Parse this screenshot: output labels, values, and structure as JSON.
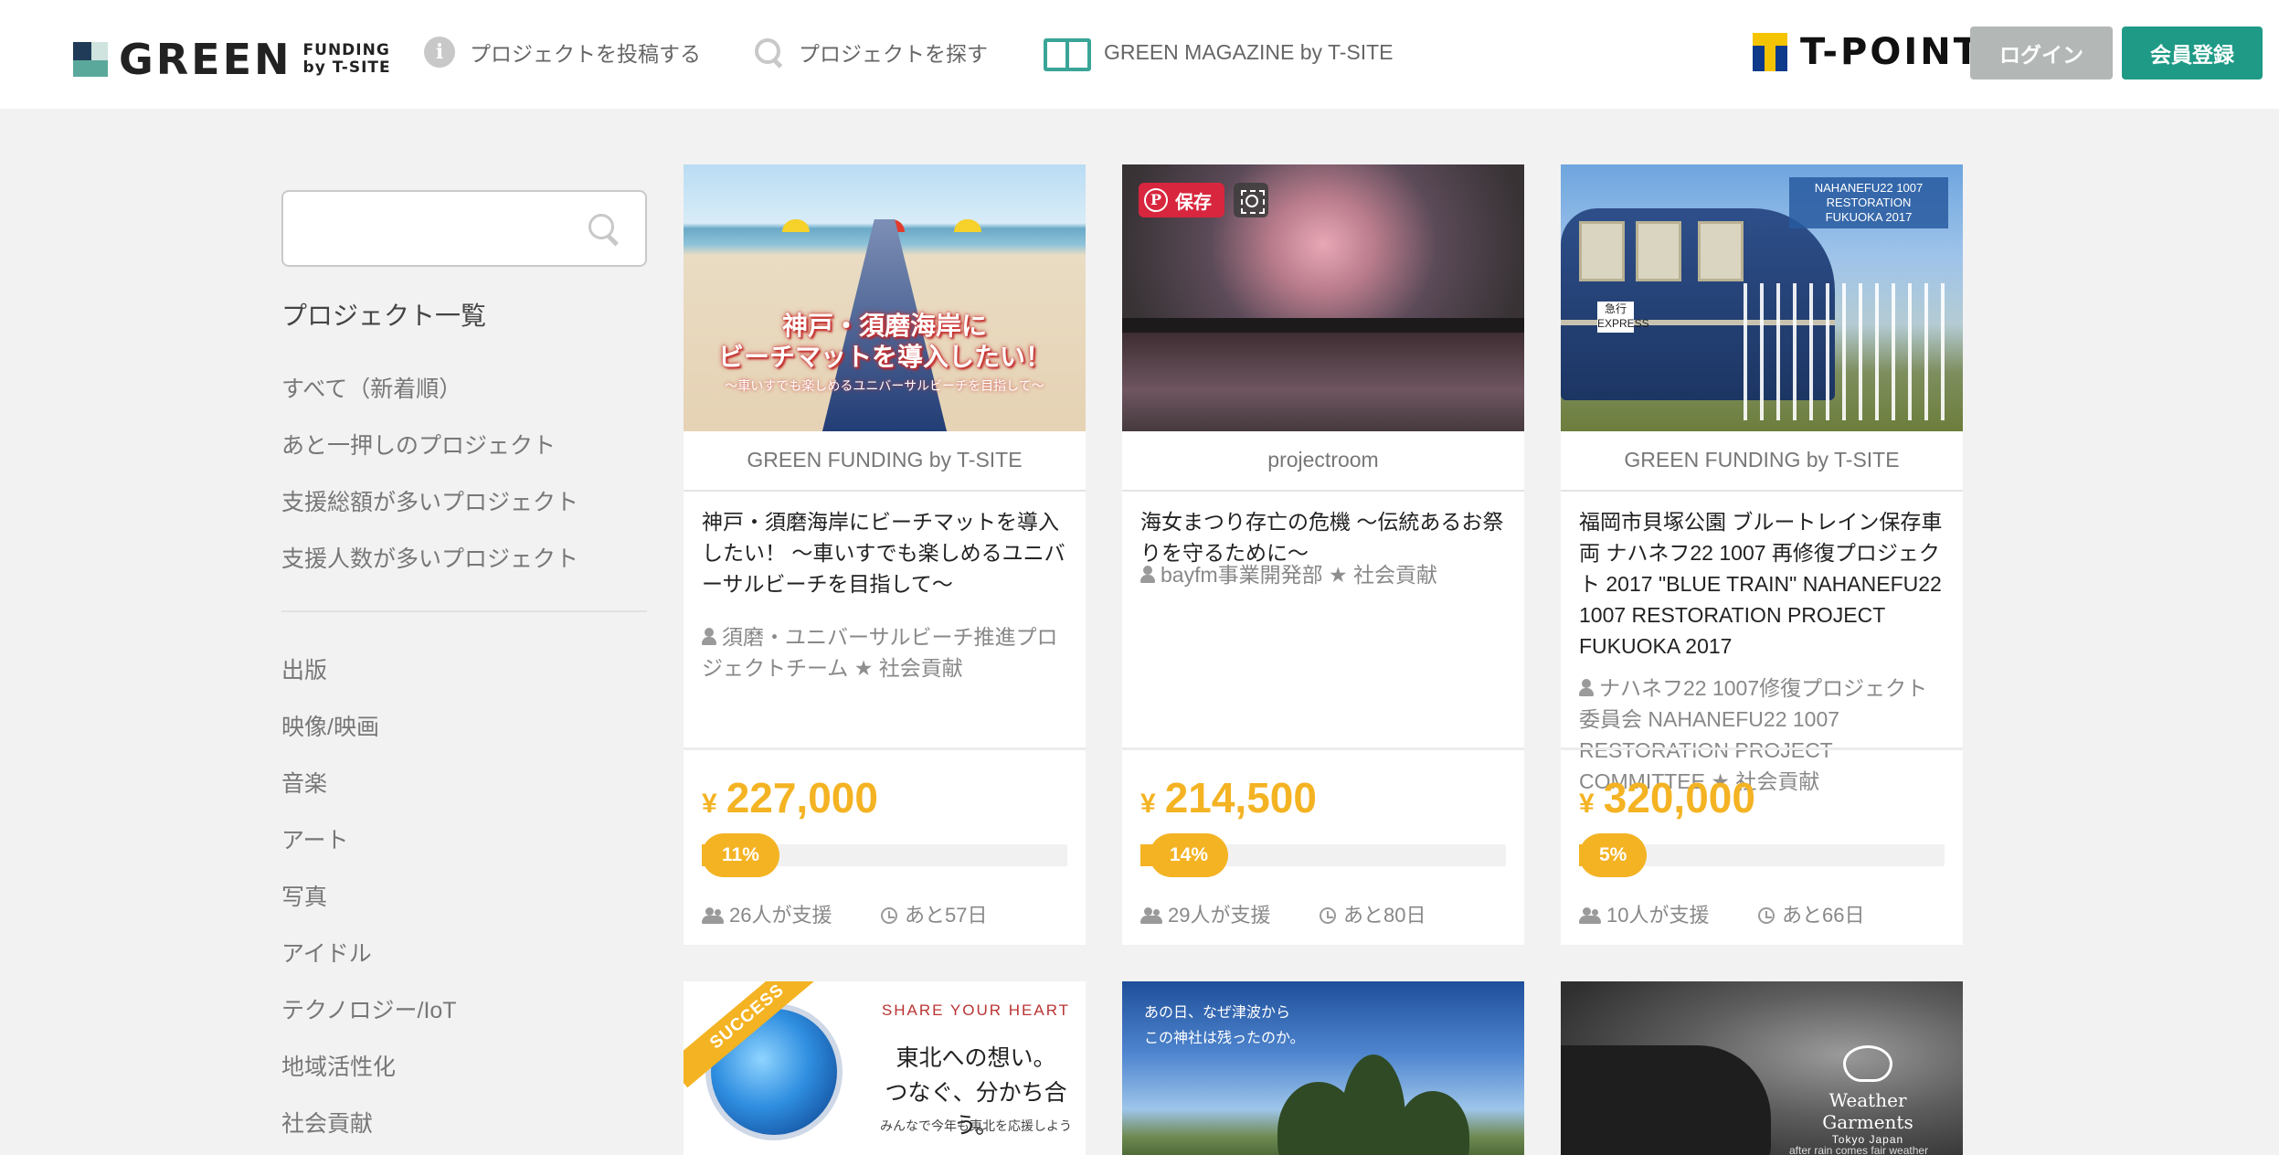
{
  "header": {
    "logo_main": "GREEN",
    "logo_sub_1": "FUNDING",
    "logo_sub_2": "by T-SITE",
    "nav": [
      {
        "label": "プロジェクトを投稿する",
        "icon": "info-icon"
      },
      {
        "label": "プロジェクトを探す",
        "icon": "search-icon"
      },
      {
        "label": "GREEN MAGAZINE by T-SITE",
        "icon": "book-icon"
      }
    ],
    "tpoint_label": "T-POINT",
    "login_label": "ログイン",
    "register_label": "会員登録"
  },
  "sidebar": {
    "search_placeholder": "",
    "heading": "プロジェクト一覧",
    "sort_links": [
      "すべて（新着順）",
      "あと一押しのプロジェクト",
      "支援総額が多いプロジェクト",
      "支援人数が多いプロジェクト"
    ],
    "categories": [
      "出版",
      "映像/映画",
      "音楽",
      "アート",
      "写真",
      "アイドル",
      "テクノロジー/IoT",
      "地域活性化",
      "社会貢献"
    ]
  },
  "cards": [
    {
      "org": "GREEN FUNDING by T-SITE",
      "title": "神戸・須磨海岸にビーチマットを導入したい！ 〜車いすでも楽しめるユニバーサルビーチを目指して〜",
      "owner": "須磨・ユニバーサルビーチ推進プロジェクトチーム",
      "tag": "社会貢献",
      "amount": "227,000",
      "percent": 11,
      "percent_label": "11%",
      "supporters": "26人が支援",
      "days_left": "あと57日",
      "image_title": "神戸・須磨海岸に\nビーチマットを導入したい！",
      "image_sub": "〜車いすでも楽しめるユニバーサルビーチを目指して〜"
    },
    {
      "org": "projectroom",
      "title": "海女まつり存亡の危機 〜伝統あるお祭りを守るために〜",
      "owner": "bayfm事業開発部",
      "tag": "社会貢献",
      "amount": "214,500",
      "percent": 14,
      "percent_label": "14%",
      "supporters": "29人が支援",
      "days_left": "あと80日",
      "pin_label": "保存"
    },
    {
      "org": "GREEN FUNDING by T-SITE",
      "title": "福岡市貝塚公園 ブルートレイン保存車両 ナハネフ22 1007 再修復プロジェクト 2017 \"BLUE TRAIN\" NAHANEFU22 1007 RESTORATION PROJECT FUKUOKA 2017",
      "owner": "ナハネフ22 1007修復プロジェクト委員会 NAHANEFU22 1007 RESTORATION PROJECT COMMITTEE",
      "tag": "社会貢献",
      "amount": "320,000",
      "percent": 5,
      "percent_label": "5%",
      "supporters": "10人が支援",
      "days_left": "あと66日",
      "image_badge": "NAHANEFU22 1007\nRESTORATION\nFUKUOKA 2017",
      "image_sign": "急行\nEXPRESS"
    }
  ],
  "row2": [
    {
      "success_label": "SUCCESS",
      "brand": "SHARE YOUR HEART",
      "line1": "東北への想い。",
      "line2": "つなぐ、分かち合う。",
      "small": "みんなで今年も東北を応援しよう"
    },
    {
      "text": "あの日、なぜ津波から\nこの神社は残ったのか。"
    },
    {
      "title": "Weather Garments",
      "sub": "Tokyo Japan",
      "foot": "after rain comes fair weather"
    }
  ],
  "colors": {
    "accent_green": "#1f9a86",
    "amount_yellow": "#f4b323",
    "login_gray": "#b3b8b7",
    "background": "#f2f2f2"
  }
}
